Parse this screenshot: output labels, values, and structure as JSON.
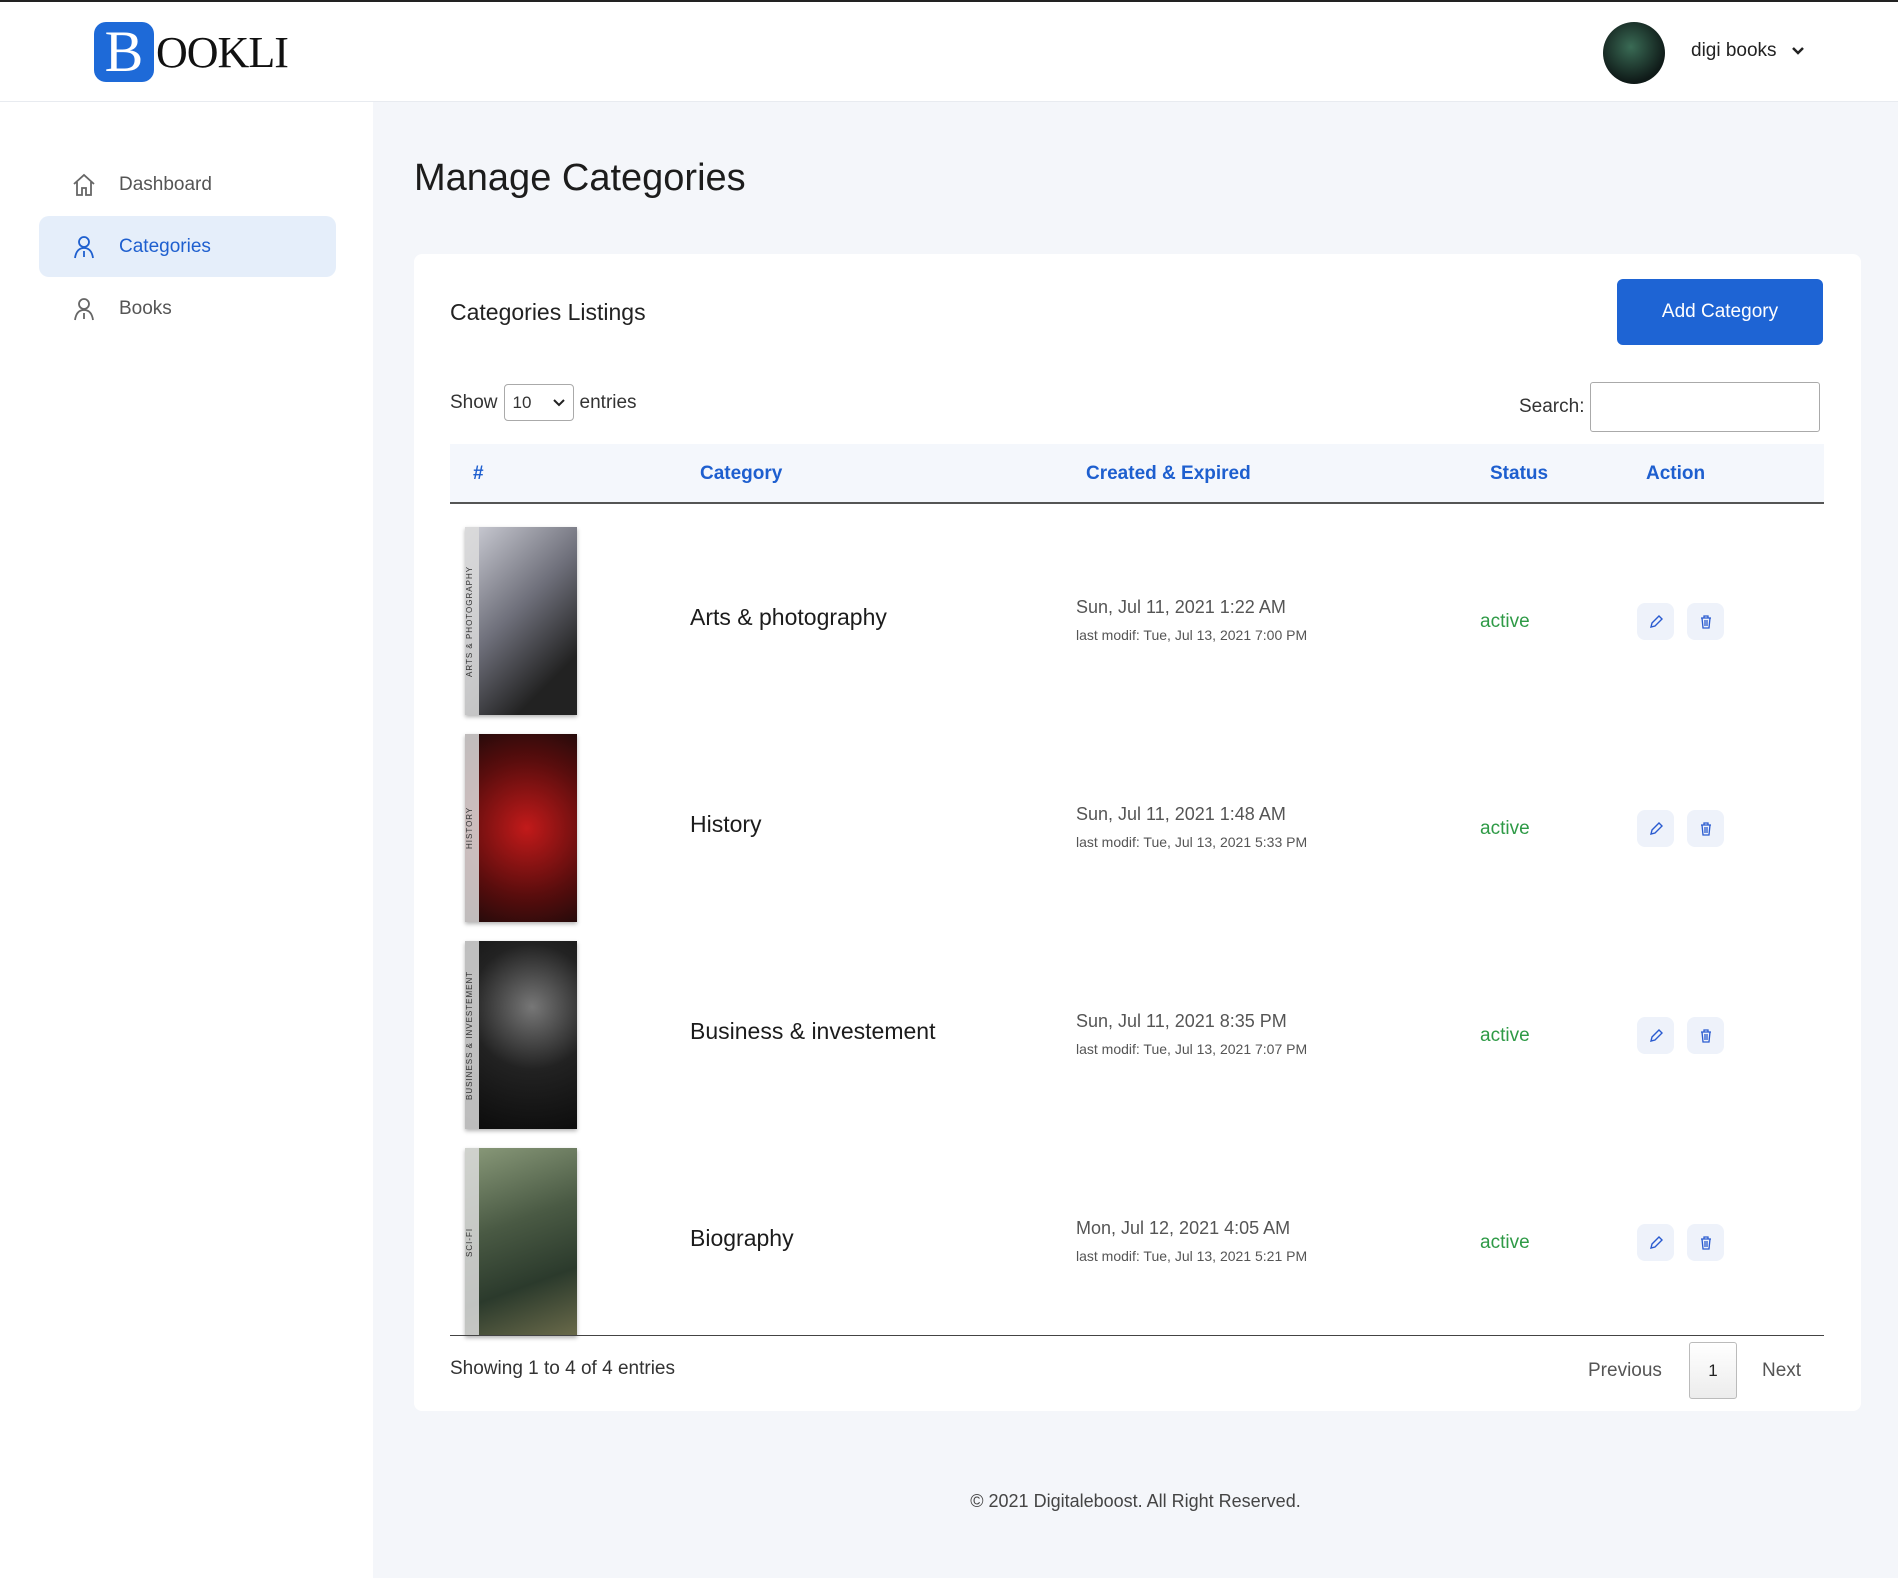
{
  "header": {
    "logo_letter": "B",
    "logo_text": "OOKLI",
    "user_name": "digi books"
  },
  "sidebar": {
    "items": [
      {
        "label": "Dashboard",
        "icon": "home-icon"
      },
      {
        "label": "Categories",
        "icon": "user-icon",
        "active": true
      },
      {
        "label": "Books",
        "icon": "user-icon"
      }
    ]
  },
  "page_title": "Manage Categories",
  "card": {
    "title": "Categories Listings",
    "add_label": "Add Category",
    "show_label": "Show",
    "entries_value": "10",
    "entries_label": "entries",
    "search_label": "Search:",
    "search_value": ""
  },
  "table": {
    "headers": [
      "#",
      "Category",
      "Created & Expired",
      "Status",
      "Action"
    ],
    "rows": [
      {
        "spine": "ARTS & PHOTOGRAPHY",
        "name": "Arts & photography",
        "created": "Sun, Jul 11, 2021 1:22 AM",
        "modified": "last modif: Tue, Jul 13, 2021 7:00 PM",
        "status": "active"
      },
      {
        "spine": "HISTORY",
        "name": "History",
        "created": "Sun, Jul 11, 2021 1:48 AM",
        "modified": "last modif: Tue, Jul 13, 2021 5:33 PM",
        "status": "active"
      },
      {
        "spine": "BUSINESS & INVESTEMENT",
        "name": "Business & investement",
        "created": "Sun, Jul 11, 2021 8:35 PM",
        "modified": "last modif: Tue, Jul 13, 2021 7:07 PM",
        "status": "active"
      },
      {
        "spine": "SCI-FI",
        "name": "Biography",
        "created": "Mon, Jul 12, 2021 4:05 AM",
        "modified": "last modif: Tue, Jul 13, 2021 5:21 PM",
        "status": "active"
      }
    ]
  },
  "pagination": {
    "info": "Showing 1 to 4 of 4 entries",
    "previous": "Previous",
    "page": "1",
    "next": "Next"
  },
  "footer": "© 2021 Digitaleboost. All Right Reserved.",
  "colors": {
    "accent": "#1e64d4",
    "active": "#2e9a46"
  }
}
